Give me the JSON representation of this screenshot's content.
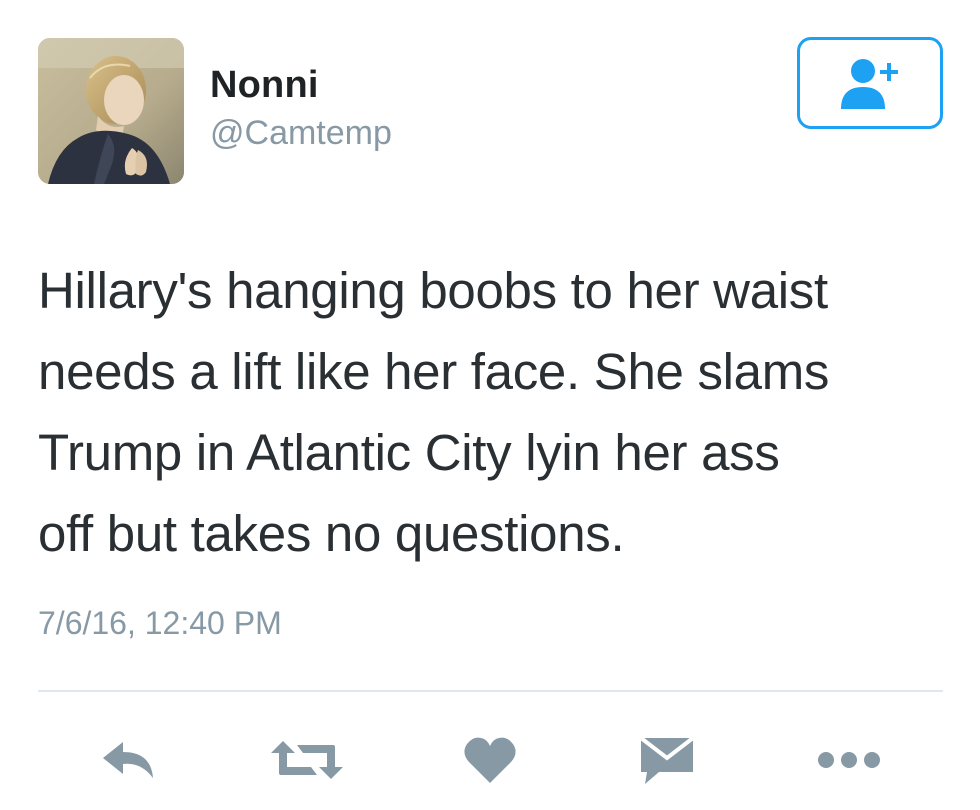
{
  "user": {
    "display_name": "Nonni",
    "handle": "@Camtemp",
    "avatar_icon": "portrait-avatar"
  },
  "follow_button": {
    "icon": "add-user-icon",
    "color": "#1da1f2"
  },
  "tweet": {
    "text": "Hillary's hanging boobs to her waist\nneeds a lift like her face. She slams\nTrump in Atlantic City lyin her ass\noff but takes no questions.",
    "timestamp": "7/6/16, 12:40 PM"
  },
  "actions": [
    {
      "name": "reply",
      "icon": "reply-icon"
    },
    {
      "name": "retweet",
      "icon": "retweet-icon"
    },
    {
      "name": "like",
      "icon": "heart-icon"
    },
    {
      "name": "direct-message",
      "icon": "envelope-icon"
    },
    {
      "name": "more",
      "icon": "more-icon"
    }
  ],
  "colors": {
    "text": "#292f33",
    "secondary": "#8899a6",
    "accent": "#1da1f2",
    "icon": "#8899a6"
  }
}
